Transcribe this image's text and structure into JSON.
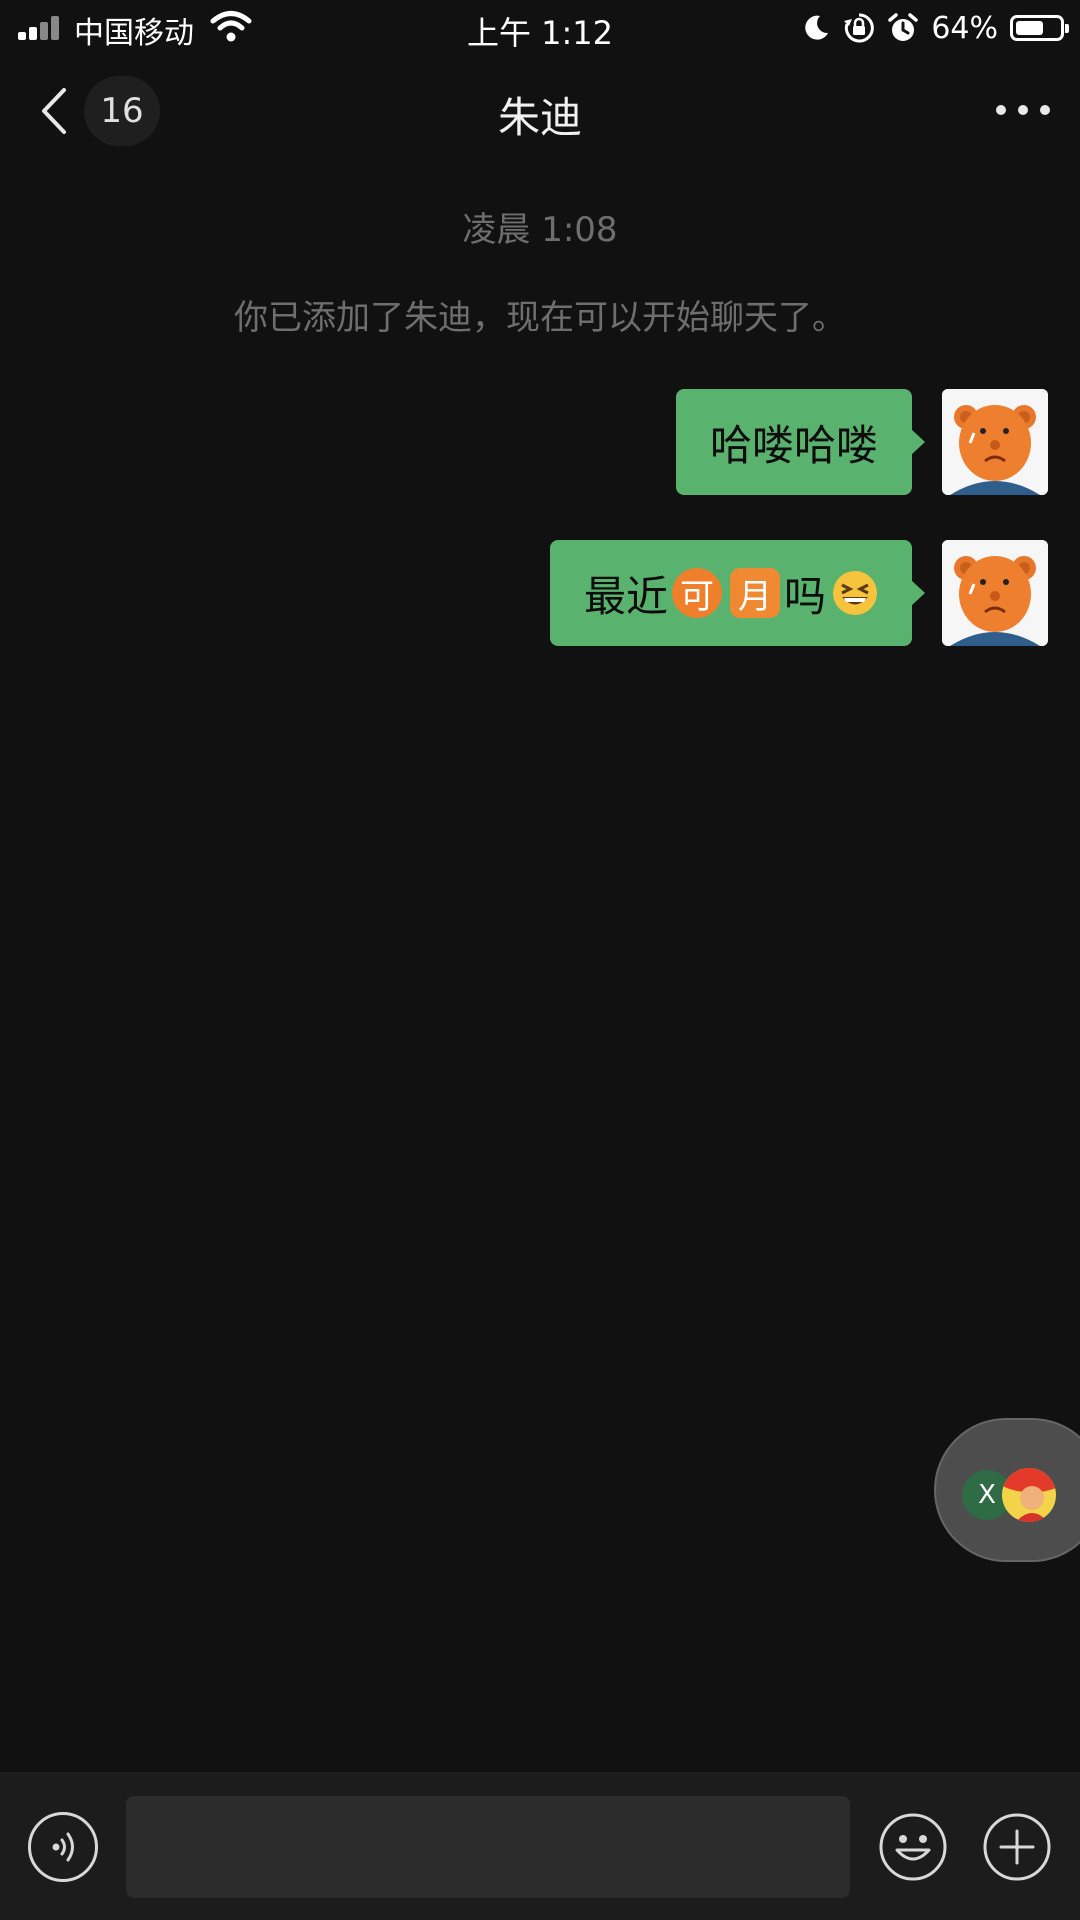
{
  "status_bar": {
    "carrier": "中国移动",
    "time": "上午 1:12",
    "battery_percent": "64%",
    "battery_level": 0.64,
    "icons": [
      "signal-icon",
      "wifi-icon",
      "moon-icon",
      "rotation-lock-icon",
      "alarm-icon",
      "battery-icon"
    ]
  },
  "nav": {
    "unread_count": "16",
    "title": "朱迪",
    "icons": [
      "back-icon",
      "more-icon"
    ]
  },
  "chat": {
    "timestamp": "凌晨 1:08",
    "system_message": "你已添加了朱迪，现在可以开始聊天了。",
    "messages": [
      {
        "sender": "self",
        "text": "哈喽哈喽"
      },
      {
        "sender": "self",
        "text_before": "最近",
        "emoji_1": "可",
        "emoji_2": "月",
        "text_after": "吗",
        "emoji_face": "grinning-squint-face-icon"
      }
    ]
  },
  "floating_window": {
    "label": "X"
  },
  "input_bar": {
    "placeholder": "",
    "icons": [
      "voice-icon",
      "emoji-icon",
      "plus-icon"
    ]
  },
  "colors": {
    "background": "#111111",
    "bubble": "#59b36e",
    "muted_text": "#6e6e6e",
    "input_bar": "#1c1c1c"
  }
}
